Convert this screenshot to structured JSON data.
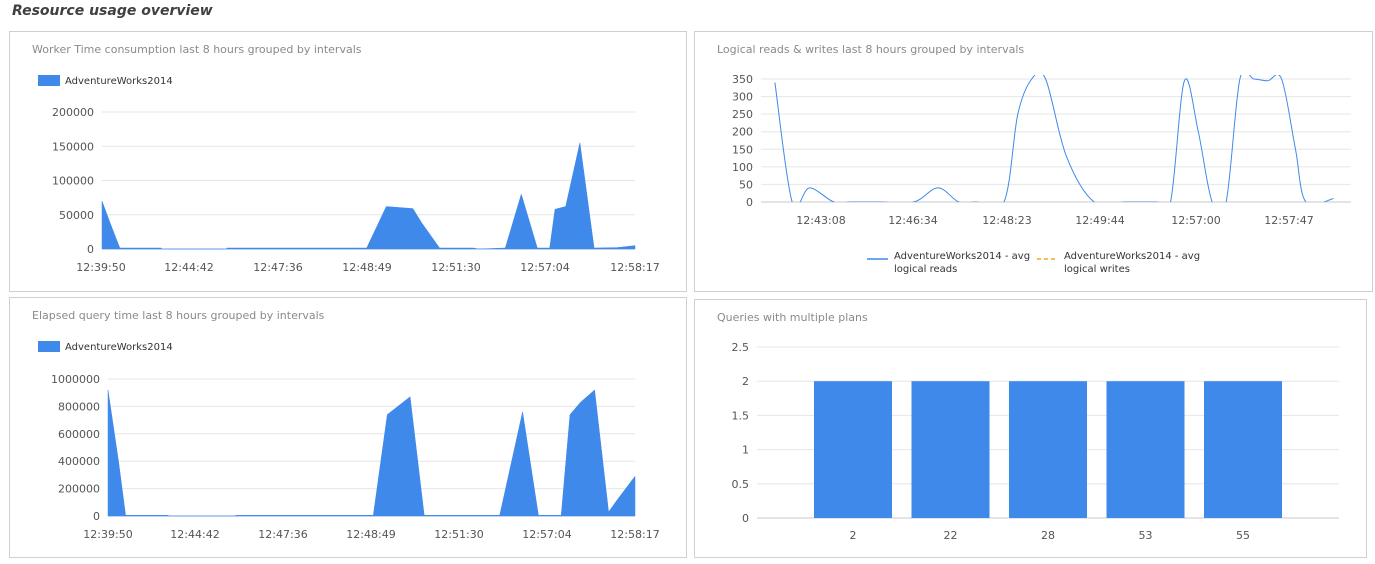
{
  "page": {
    "title": "Resource usage overview"
  },
  "colors": {
    "series": "#3f89ea",
    "writes": "#f5a623",
    "grid": "#e6e6e6",
    "axis": "#c8c8c8"
  },
  "chart_data": [
    {
      "id": "worker",
      "type": "area",
      "title": "Worker Time consumption last 8 hours grouped by intervals",
      "legend": {
        "position": "top-left",
        "entries": [
          "AdventureWorks2014"
        ]
      },
      "x_tick_labels": [
        "12:39:50",
        "12:44:42",
        "12:47:36",
        "12:48:49",
        "12:51:30",
        "12:57:04",
        "12:58:17"
      ],
      "y_ticks": [
        0,
        50000,
        100000,
        150000,
        200000
      ],
      "ylim": [
        0,
        200000
      ],
      "series": [
        {
          "name": "AdventureWorks2014",
          "x": [
            0,
            0.5,
            1,
            3.33,
            3.36,
            7,
            7.03,
            10,
            14.9,
            16,
            17.5,
            18,
            19,
            20.9,
            21.2,
            22.7,
            23.6,
            24.5,
            25.2,
            25.5,
            26.1,
            26.9,
            27.7,
            29.0,
            30.0
          ],
          "values": [
            70000,
            35000,
            1500,
            1500,
            0,
            0,
            1500,
            1500,
            1500,
            62000,
            59000,
            38000,
            1500,
            1500,
            0,
            1500,
            80000,
            1500,
            1500,
            58000,
            62000,
            155000,
            1500,
            2000,
            5000
          ]
        }
      ]
    },
    {
      "id": "reads",
      "type": "line",
      "title": "Logical reads & writes last 8 hours grouped by intervals",
      "legend": {
        "position": "bottom",
        "entries": [
          "AdventureWorks2014 - avg logical reads",
          "AdventureWorks2014 - avg logical writes"
        ]
      },
      "x_tick_labels": [
        "12:43:08",
        "12:46:34",
        "12:48:23",
        "12:49:44",
        "12:57:00",
        "12:57:47"
      ],
      "y_ticks": [
        0,
        50,
        100,
        150,
        200,
        250,
        300,
        350
      ],
      "ylim": [
        0,
        350
      ],
      "series": [
        {
          "name": "AdventureWorks2014 - avg logical reads",
          "x": [
            0.4,
            0.9,
            1.4,
            2.1,
            2.6,
            3.4,
            4.4,
            5.1,
            5.7,
            6.2,
            7.0,
            7.4,
            7.8,
            8.2,
            8.8,
            9.6,
            10.5,
            11.4,
            11.8,
            12.2,
            12.6,
            13.0,
            13.4,
            13.8,
            14.2,
            14.6,
            15.0,
            15.4,
            15.7,
            16.5
          ],
          "values": [
            340,
            0,
            40,
            0,
            0,
            0,
            0,
            40,
            0,
            0,
            0,
            250,
            350,
            350,
            130,
            0,
            0,
            0,
            0,
            345,
            200,
            0,
            0,
            350,
            350,
            345,
            350,
            150,
            0,
            10
          ]
        },
        {
          "name": "AdventureWorks2014 - avg logical writes",
          "x": [
            0.4,
            16.5
          ],
          "values": [
            0,
            0
          ]
        }
      ]
    },
    {
      "id": "elapsed",
      "type": "area",
      "title": "Elapsed query time last 8 hours grouped by intervals",
      "legend": {
        "position": "top-left",
        "entries": [
          "AdventureWorks2014"
        ]
      },
      "x_tick_labels": [
        "12:39:50",
        "12:44:42",
        "12:47:36",
        "12:48:49",
        "12:51:30",
        "12:57:04",
        "12:58:17"
      ],
      "y_ticks": [
        0,
        200000,
        400000,
        600000,
        800000,
        1000000
      ],
      "ylim": [
        0,
        1000000
      ],
      "series": [
        {
          "name": "AdventureWorks2014",
          "x": [
            0,
            0.6,
            1,
            3.4,
            3.5,
            7.2,
            7.3,
            10,
            15.1,
            15.9,
            17.2,
            18,
            19,
            22.3,
            23.6,
            24.5,
            25.8,
            26.3,
            26.9,
            27.7,
            28.5,
            29.0,
            30.0
          ],
          "values": [
            920000,
            400000,
            5000,
            5000,
            0,
            0,
            5000,
            5000,
            5000,
            740000,
            870000,
            5000,
            5000,
            5000,
            760000,
            5000,
            5000,
            740000,
            830000,
            920000,
            30000,
            120000,
            290000
          ]
        }
      ]
    },
    {
      "id": "plans",
      "type": "bar",
      "title": "Queries with multiple plans",
      "categories": [
        "2",
        "22",
        "28",
        "53",
        "55"
      ],
      "values": [
        2,
        2,
        2,
        2,
        2
      ],
      "y_ticks": [
        0,
        0.5,
        1,
        1.5,
        2,
        2.5
      ],
      "ylim": [
        0,
        2.5
      ]
    }
  ]
}
